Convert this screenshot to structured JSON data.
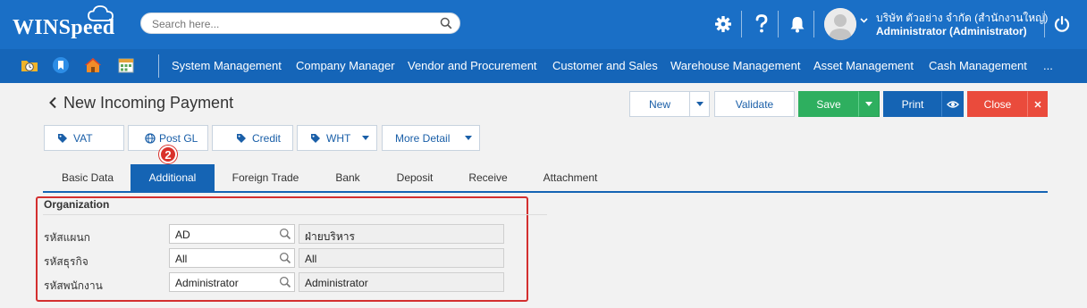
{
  "header": {
    "logo": "WINSpeed",
    "search_placeholder": "Search here...",
    "user_company": "บริษัท ตัวอย่าง จำกัด (สำนักงานใหญ่)",
    "user_name": "Administrator (Administrator)",
    "icons": [
      "gear-icon",
      "help-icon",
      "bell-icon",
      "avatar",
      "power-icon"
    ]
  },
  "quick_icons": [
    "clock-folder-icon",
    "bookmark-icon",
    "home-icon",
    "calendar-icon"
  ],
  "menu": {
    "items": [
      "System Management",
      "Company Manager",
      "Vendor and Procurement",
      "Customer and Sales",
      "Warehouse Management",
      "Asset Management",
      "Cash Management",
      "..."
    ]
  },
  "page": {
    "title": "New Incoming Payment"
  },
  "actions": {
    "new": "New",
    "validate": "Validate",
    "save": "Save",
    "print": "Print",
    "close": "Close"
  },
  "toolbar": {
    "vat": "VAT",
    "post_gl": "Post GL",
    "credit": "Credit",
    "wht": "WHT",
    "more_detail": "More Detail",
    "step_badge": "2"
  },
  "tabs": [
    "Basic Data",
    "Additional",
    "Foreign Trade",
    "Bank",
    "Deposit",
    "Receive",
    "Attachment"
  ],
  "active_tab": "Additional",
  "organization": {
    "title": "Organization",
    "fields": [
      {
        "label": "รหัสแผนก",
        "code": "AD",
        "desc": "ฝ่ายบริหาร"
      },
      {
        "label": "รหัสธุรกิจ",
        "code": "All",
        "desc": "All"
      },
      {
        "label": "รหัสพนักงาน",
        "code": "Administrator",
        "desc": "Administrator"
      }
    ]
  },
  "colors": {
    "header_bg": "#1a6fc6",
    "menubar_bg": "#1565b8",
    "active_tab": "#1564b4",
    "save": "#2eaf5f",
    "close": "#ea4b3c",
    "highlight_box": "#d32f2f"
  }
}
